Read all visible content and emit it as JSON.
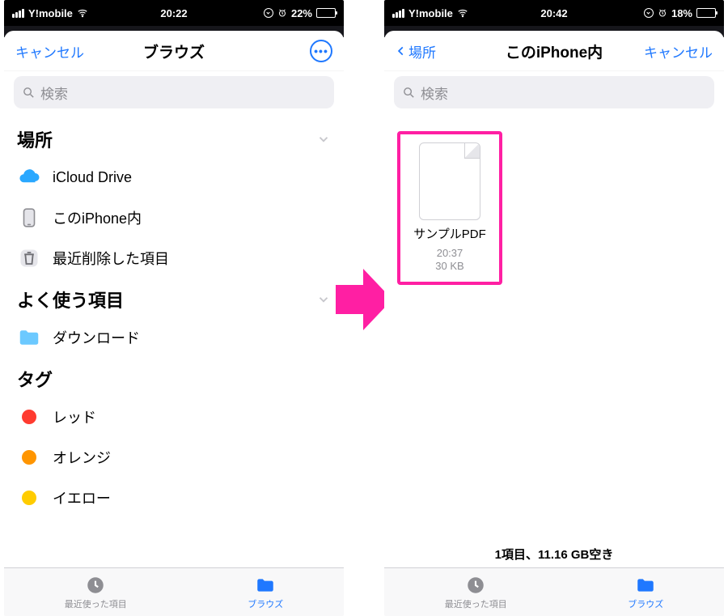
{
  "left": {
    "status": {
      "carrier": "Y!mobile",
      "time": "20:22",
      "battery_pct": "22%"
    },
    "nav": {
      "cancel": "キャンセル",
      "title": "ブラウズ"
    },
    "search_placeholder": "検索",
    "sections": {
      "locations": {
        "header": "場所",
        "items": [
          {
            "label": "iCloud Drive"
          },
          {
            "label": "このiPhone内"
          },
          {
            "label": "最近削除した項目"
          }
        ]
      },
      "favorites": {
        "header": "よく使う項目",
        "items": [
          {
            "label": "ダウンロード"
          }
        ]
      },
      "tags": {
        "header": "タグ",
        "items": [
          {
            "label": "レッド",
            "color": "#ff3b30"
          },
          {
            "label": "オレンジ",
            "color": "#ff9500"
          },
          {
            "label": "イエロー",
            "color": "#ffcc00"
          }
        ]
      }
    },
    "tabs": {
      "recents": "最近使った項目",
      "browse": "ブラウズ"
    }
  },
  "right": {
    "status": {
      "carrier": "Y!mobile",
      "time": "20:42",
      "battery_pct": "18%"
    },
    "nav": {
      "back": "場所",
      "title": "このiPhone内",
      "cancel": "キャンセル"
    },
    "search_placeholder": "検索",
    "file": {
      "name": "サンプルPDF",
      "time": "20:37",
      "size": "30 KB"
    },
    "footer": "1項目、11.16 GB空き",
    "tabs": {
      "recents": "最近使った項目",
      "browse": "ブラウズ"
    }
  }
}
